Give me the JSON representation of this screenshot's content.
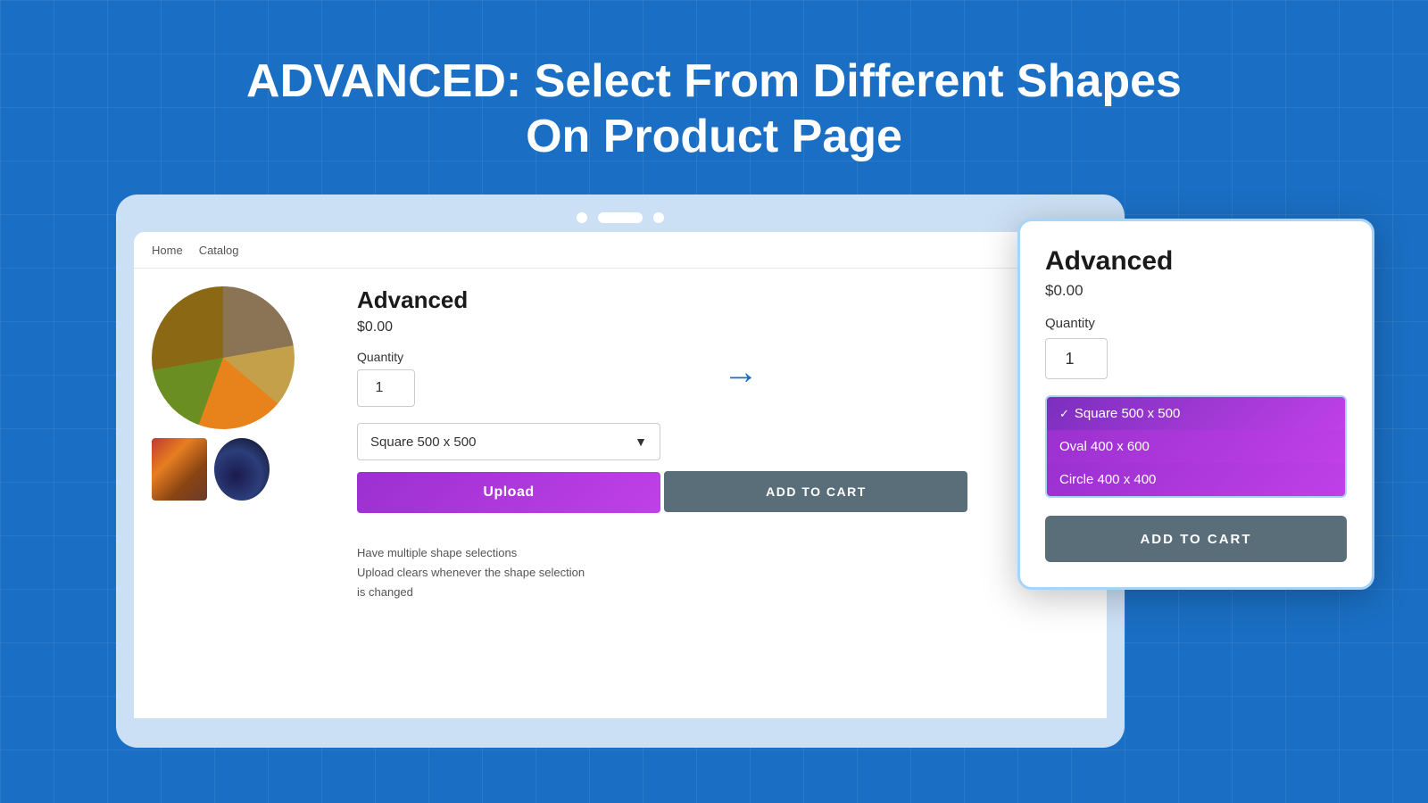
{
  "page": {
    "title_line1": "ADVANCED: Select From Different Shapes",
    "title_line2": "On Product Page",
    "background_color": "#1a6fc4"
  },
  "nav": {
    "home_label": "Home",
    "catalog_label": "Catalog"
  },
  "browser_product": {
    "name": "Advanced",
    "price": "$0.00",
    "quantity_label": "Quantity",
    "quantity_value": "1",
    "shape_option": "Square 500 x 500",
    "upload_label": "Upload",
    "add_to_cart_label": "ADD TO CART",
    "feature_text_1": "Have multiple shape selections",
    "feature_text_2": "Upload clears whenever the shape selection",
    "feature_text_3": "is changed"
  },
  "popup": {
    "name": "Advanced",
    "price": "$0.00",
    "quantity_label": "Quantity",
    "quantity_value": "1",
    "dropdown_options": [
      {
        "label": "Square 500 x 500",
        "selected": true
      },
      {
        "label": "Oval 400 x 600",
        "selected": false
      },
      {
        "label": "Circle 400 x 400",
        "selected": false
      }
    ],
    "add_to_cart_label": "ADD TO CART"
  },
  "pagination": {
    "dots": 3
  }
}
